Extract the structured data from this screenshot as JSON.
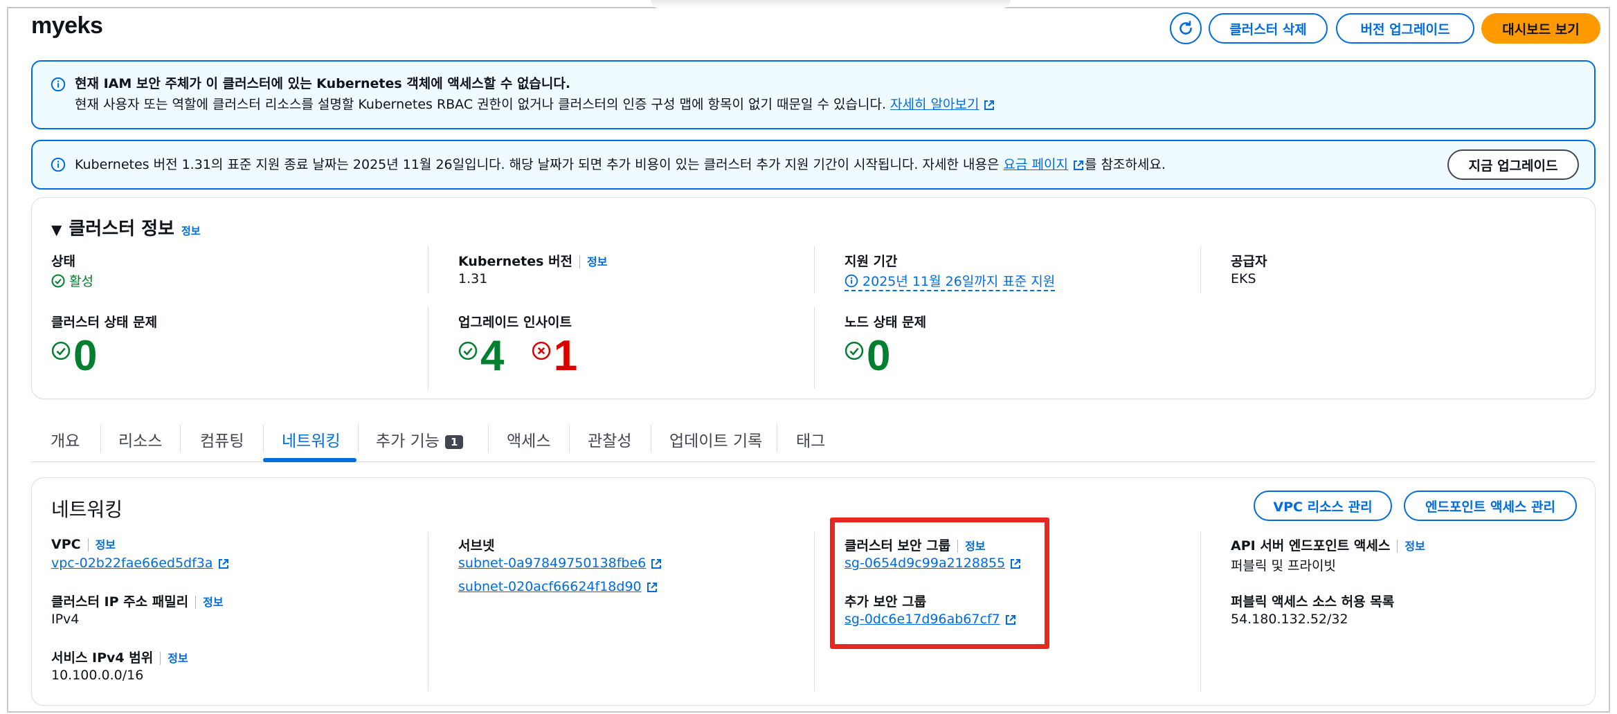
{
  "header": {
    "title": "myeks",
    "buttons": {
      "delete": "클러스터 삭제",
      "upgrade": "버전 업그레이드",
      "dashboard": "대시보드 보기"
    }
  },
  "alerts": {
    "iam": {
      "title": "현재 IAM 보안 주체가 이 클러스터에 있는 Kubernetes 객체에 액세스할 수 없습니다.",
      "body": "현재 사용자 또는 역할에 클러스터 리소스를 설명할 Kubernetes RBAC 권한이 없거나 클러스터의 인증 구성 맵에 항목이 없기 때문일 수 있습니다.",
      "link": "자세히 알아보기"
    },
    "version": {
      "text_before": "Kubernetes 버전 1.31의 표준 지원 종료 날짜는 2025년 11월 26일입니다. 해당 날짜가 되면 추가 비용이 있는 클러스터 추가 지원 기간이 시작됩니다. 자세한 내용은",
      "link": "요금 페이지",
      "text_after": "를 참조하세요.",
      "button": "지금 업그레이드"
    }
  },
  "cluster_info": {
    "heading": "클러스터 정보",
    "info": "정보",
    "status_label": "상태",
    "status_value": "활성",
    "k8s_label": "Kubernetes 버전",
    "k8s_value": "1.31",
    "support_label": "지원 기간",
    "support_value": "2025년 11월 26일까지 표준 지원",
    "provider_label": "공급자",
    "provider_value": "EKS",
    "health_label": "클러스터 상태 문제",
    "health_count": "0",
    "insights_label": "업그레이드 인사이트",
    "insights_ok": "4",
    "insights_err": "1",
    "node_label": "노드 상태 문제",
    "node_count": "0"
  },
  "tabs": [
    {
      "label": "개요"
    },
    {
      "label": "리소스"
    },
    {
      "label": "컴퓨팅"
    },
    {
      "label": "네트워킹"
    },
    {
      "label": "추가 기능",
      "badge": "1"
    },
    {
      "label": "액세스"
    },
    {
      "label": "관찰성"
    },
    {
      "label": "업데이트 기록"
    },
    {
      "label": "태그"
    }
  ],
  "networking": {
    "heading": "네트워킹",
    "manage_vpc": "VPC 리소스 관리",
    "manage_endpoint": "엔드포인트 액세스 관리",
    "info": "정보",
    "vpc_label": "VPC",
    "vpc_value": "vpc-02b22fae66ed5df3a",
    "ip_family_label": "클러스터 IP 주소 패밀리",
    "ip_family_value": "IPv4",
    "svc_range_label": "서비스 IPv4 범위",
    "svc_range_value": "10.100.0.0/16",
    "subnet_label": "서브넷",
    "subnets": [
      "subnet-0a97849750138fbe6",
      "subnet-020acf66624f18d90"
    ],
    "cluster_sg_label": "클러스터 보안 그룹",
    "cluster_sg_value": "sg-0654d9c99a2128855",
    "extra_sg_label": "추가 보안 그룹",
    "extra_sg_value": "sg-0dc6e17d96ab67cf7",
    "api_access_label": "API 서버 엔드포인트 액세스",
    "api_access_value": "퍼블릭 및 프라이빗",
    "allowlist_label": "퍼블릭 액세스 소스 허용 목록",
    "allowlist_value": "54.180.132.52/32"
  },
  "colors": {
    "accent": "#006ce0",
    "primary_button": "#ff9900",
    "success": "#00802f",
    "error": "#db0000",
    "highlight": "#e8281e"
  }
}
